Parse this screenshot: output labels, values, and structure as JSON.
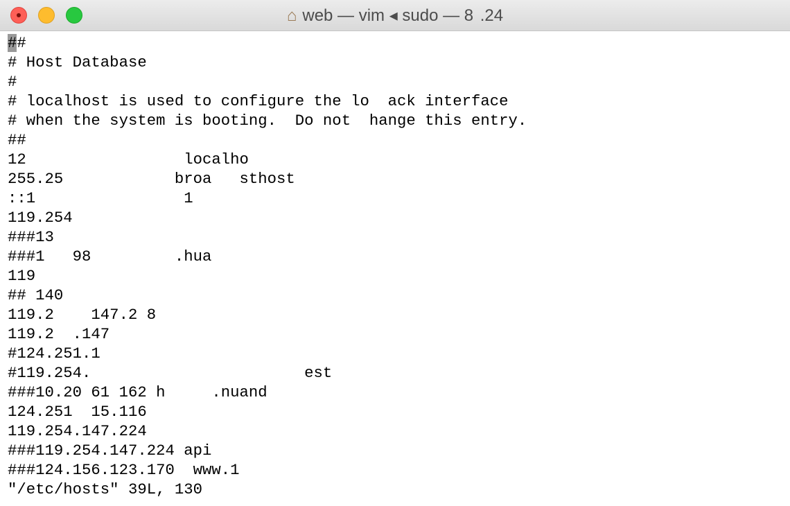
{
  "window": {
    "title": "web — vim ◂ sudo — 8  .24",
    "title_icon": "home-icon"
  },
  "editor": {
    "cursor_char": "#",
    "lines": [
      "#",
      "# Host Database",
      "#",
      "# localhost is used to configure the lo  ack interface",
      "# when the system is booting.  Do not  hange this entry.",
      "##",
      "12                 localho",
      "255.25            broa   sthost",
      "::1                1",
      "119.254           ",
      "###13",
      "###1   98         .hua",
      "119",
      "## 140",
      "119.2    147.2 8",
      "119.2  .147",
      "#124.251.1",
      "#119.254.                       est",
      "###10.20 61 162 h     .nuand",
      "124.251  15.116",
      "119.254.147.224",
      "###119.254.147.224 api",
      "###124.156.123.170  www.1",
      "\"/etc/hosts\" 39L, 130"
    ]
  }
}
